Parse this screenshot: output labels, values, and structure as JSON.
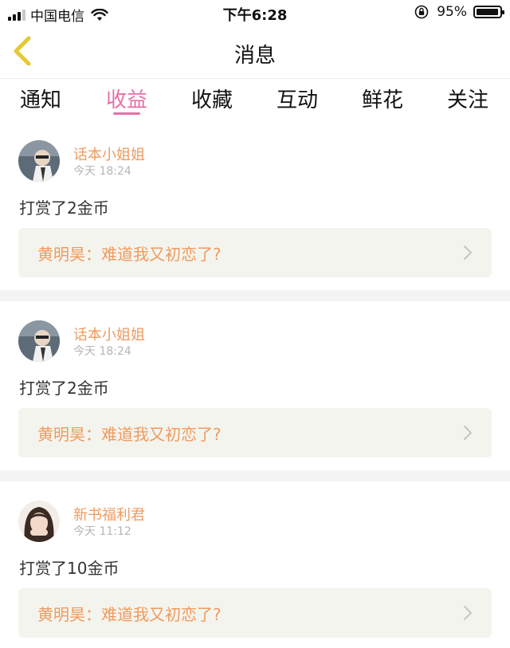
{
  "status_bar": {
    "carrier": "中国电信",
    "time": "下午6:28",
    "battery": "95%"
  },
  "nav": {
    "title": "消息",
    "back_icon": "chevron-left-icon"
  },
  "tabs": [
    {
      "label": "通知",
      "active": false
    },
    {
      "label": "收益",
      "active": true
    },
    {
      "label": "收藏",
      "active": false
    },
    {
      "label": "互动",
      "active": false
    },
    {
      "label": "鲜花",
      "active": false
    },
    {
      "label": "关注",
      "active": false
    }
  ],
  "items": [
    {
      "username": "话本小姐姐",
      "time": "今天 18:24",
      "message": "打赏了2金币",
      "quote": "黄明昊：难道我又初恋了?"
    },
    {
      "username": "话本小姐姐",
      "time": "今天 18:24",
      "message": "打赏了2金币",
      "quote": "黄明昊：难道我又初恋了?"
    },
    {
      "username": "新书福利君",
      "time": "今天 11:12",
      "message": "打赏了10金币",
      "quote": "黄明昊：难道我又初恋了?"
    }
  ],
  "colors": {
    "accent": "#e86fa8",
    "username": "#ef9a5e",
    "quote_bg": "#f4f4ee",
    "back_arrow": "#e8c833"
  }
}
